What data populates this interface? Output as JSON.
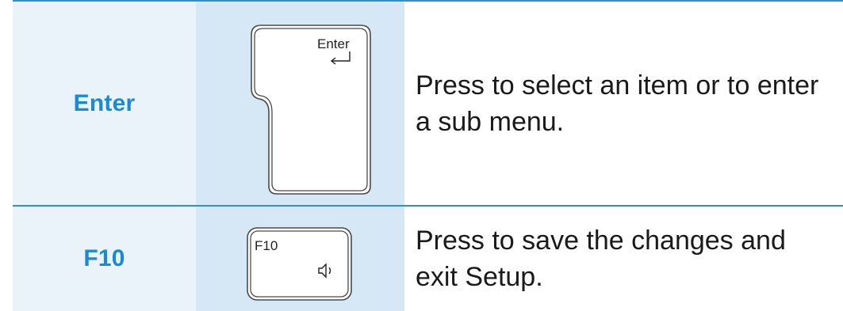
{
  "rows": [
    {
      "key_name": "Enter",
      "keycap_label": "Enter",
      "keycap_icon": "return-arrow-icon",
      "description": "Press to select an item or to enter a sub menu."
    },
    {
      "key_name": "F10",
      "keycap_label": "F10",
      "keycap_icon": "speaker-volume-icon",
      "description": "Press to save the changes and exit Setup."
    }
  ],
  "colors": {
    "accent": "#1a8ad4",
    "rule": "#2b93cc",
    "name_column_bg": "#eaf3fa",
    "key_column_bg": "#d6e7f5"
  }
}
